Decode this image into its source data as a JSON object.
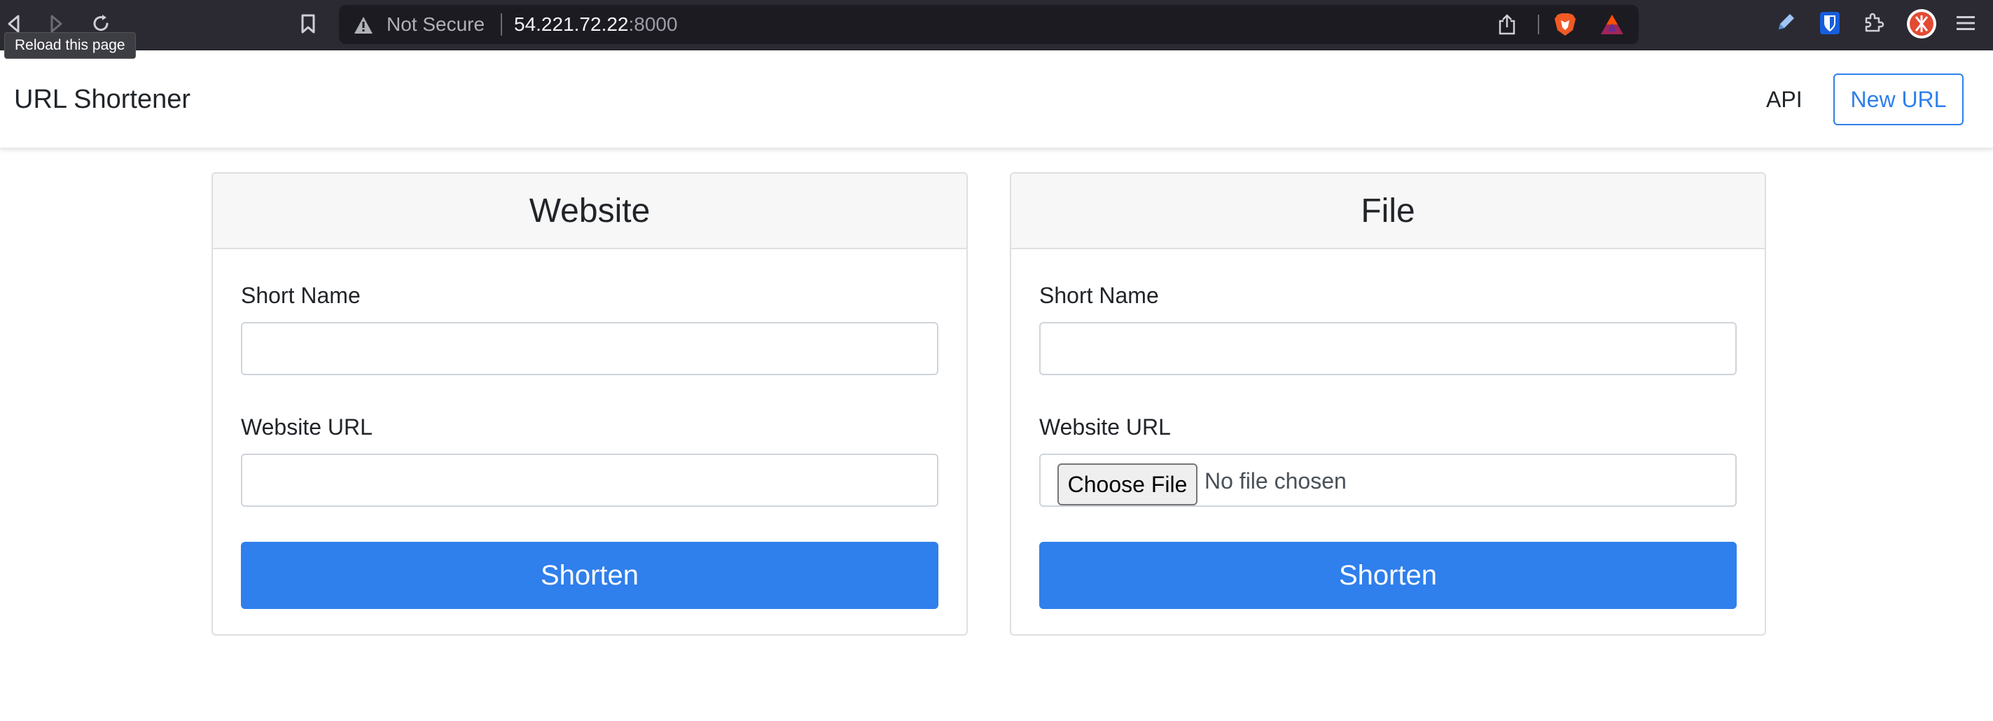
{
  "browser": {
    "tooltip": "Reload this page",
    "security_label": "Not Secure",
    "url_host": "54.221.72.22",
    "url_port": ":8000"
  },
  "navbar": {
    "brand": "URL Shortener",
    "api_link": "API",
    "new_url_button": "New URL",
    "accent_color": "#2f7fec"
  },
  "cards": {
    "website": {
      "title": "Website",
      "short_name_label": "Short Name",
      "short_name_value": "",
      "url_label": "Website URL",
      "url_value": "",
      "submit_label": "Shorten"
    },
    "file": {
      "title": "File",
      "short_name_label": "Short Name",
      "short_name_value": "",
      "url_label": "Website URL",
      "file_button_label": "Choose File",
      "file_status": "No file chosen",
      "submit_label": "Shorten"
    }
  },
  "icons": {
    "back": "back-arrow-icon",
    "forward": "forward-arrow-icon",
    "reload": "reload-icon",
    "bookmark": "bookmark-icon",
    "warning": "warning-triangle-icon",
    "share": "share-icon",
    "brave": "brave-lion-icon",
    "rewards": "brave-rewards-icon",
    "pen": "pen-extension-icon",
    "bitwarden": "bitwarden-shield-icon",
    "extensions": "puzzle-piece-icon",
    "profile": "profile-avatar-icon",
    "menu": "hamburger-menu-icon"
  }
}
